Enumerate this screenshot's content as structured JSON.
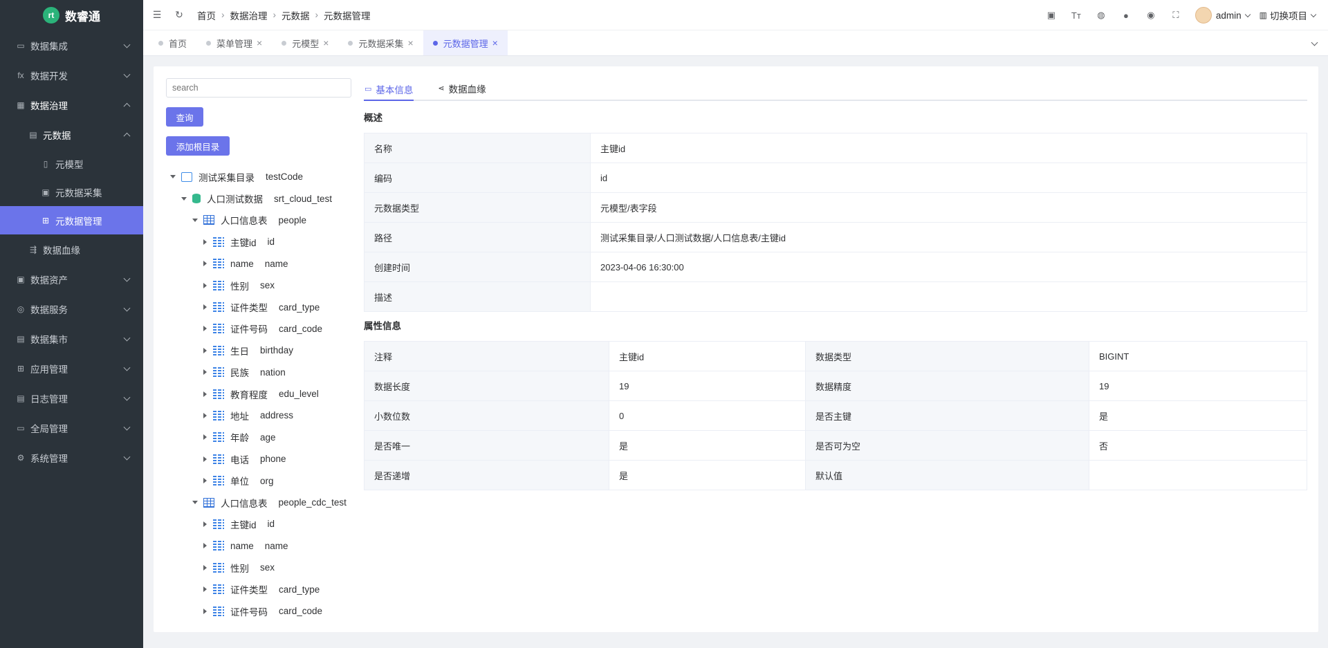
{
  "app": {
    "name": "数睿通",
    "logo_text": "rt"
  },
  "sidebar": {
    "items": [
      {
        "label": "数据集成",
        "icon": "monitor-icon",
        "glyph": "▭"
      },
      {
        "label": "数据开发",
        "icon": "fx-icon",
        "glyph": "fx"
      },
      {
        "label": "数据治理",
        "icon": "grid-icon",
        "glyph": "▦"
      },
      {
        "label": "元数据",
        "icon": "document-icon",
        "glyph": "▤"
      },
      {
        "label": "元模型",
        "icon": "file-icon",
        "glyph": "▯"
      },
      {
        "label": "元数据采集",
        "icon": "collect-icon",
        "glyph": "▣"
      },
      {
        "label": "元数据管理",
        "icon": "manage-icon",
        "glyph": "⊞"
      },
      {
        "label": "数据血缘",
        "icon": "lineage-icon",
        "glyph": "⇶"
      },
      {
        "label": "数据资产",
        "icon": "asset-icon",
        "glyph": "▣"
      },
      {
        "label": "数据服务",
        "icon": "service-icon",
        "glyph": "◎"
      },
      {
        "label": "数据集市",
        "icon": "market-icon",
        "glyph": "▤"
      },
      {
        "label": "应用管理",
        "icon": "apps-icon",
        "glyph": "⊞"
      },
      {
        "label": "日志管理",
        "icon": "log-icon",
        "glyph": "▤"
      },
      {
        "label": "全局管理",
        "icon": "global-icon",
        "glyph": "▭"
      },
      {
        "label": "系统管理",
        "icon": "settings-icon",
        "glyph": "⚙"
      }
    ]
  },
  "topbar": {
    "breadcrumbs": [
      "首页",
      "数据治理",
      "元数据",
      "元数据管理"
    ],
    "user": "admin",
    "project_switch": "切换项目"
  },
  "tabs": [
    {
      "label": "首页"
    },
    {
      "label": "菜单管理"
    },
    {
      "label": "元模型"
    },
    {
      "label": "元数据采集"
    },
    {
      "label": "元数据管理"
    }
  ],
  "left_panel": {
    "search_placeholder": "search",
    "query_button": "查询",
    "add_root_button": "添加根目录"
  },
  "tree": [
    {
      "depth": 0,
      "type": "folder",
      "name": "测试采集目录",
      "code": "testCode",
      "expanded": true
    },
    {
      "depth": 1,
      "type": "db",
      "name": "人口测试数据",
      "code": "srt_cloud_test",
      "expanded": true
    },
    {
      "depth": 2,
      "type": "table",
      "name": "人口信息表",
      "code": "people",
      "expanded": true
    },
    {
      "depth": 3,
      "type": "field",
      "name": "主键id",
      "code": "id"
    },
    {
      "depth": 3,
      "type": "field",
      "name": "name",
      "code": "name"
    },
    {
      "depth": 3,
      "type": "field",
      "name": "性别",
      "code": "sex"
    },
    {
      "depth": 3,
      "type": "field",
      "name": "证件类型",
      "code": "card_type"
    },
    {
      "depth": 3,
      "type": "field",
      "name": "证件号码",
      "code": "card_code"
    },
    {
      "depth": 3,
      "type": "field",
      "name": "生日",
      "code": "birthday"
    },
    {
      "depth": 3,
      "type": "field",
      "name": "民族",
      "code": "nation"
    },
    {
      "depth": 3,
      "type": "field",
      "name": "教育程度",
      "code": "edu_level"
    },
    {
      "depth": 3,
      "type": "field",
      "name": "地址",
      "code": "address"
    },
    {
      "depth": 3,
      "type": "field",
      "name": "年龄",
      "code": "age"
    },
    {
      "depth": 3,
      "type": "field",
      "name": "电话",
      "code": "phone"
    },
    {
      "depth": 3,
      "type": "field",
      "name": "单位",
      "code": "org"
    },
    {
      "depth": 2,
      "type": "table",
      "name": "人口信息表",
      "code": "people_cdc_test",
      "expanded": true
    },
    {
      "depth": 3,
      "type": "field",
      "name": "主键id",
      "code": "id"
    },
    {
      "depth": 3,
      "type": "field",
      "name": "name",
      "code": "name"
    },
    {
      "depth": 3,
      "type": "field",
      "name": "性别",
      "code": "sex"
    },
    {
      "depth": 3,
      "type": "field",
      "name": "证件类型",
      "code": "card_type"
    },
    {
      "depth": 3,
      "type": "field",
      "name": "证件号码",
      "code": "card_code"
    }
  ],
  "detail": {
    "tabs": [
      {
        "label": "基本信息"
      },
      {
        "label": "数据血缘"
      }
    ],
    "overview_title": "概述",
    "overview": [
      {
        "key": "名称",
        "value": "主键id"
      },
      {
        "key": "编码",
        "value": "id"
      },
      {
        "key": "元数据类型",
        "value": "元模型/表字段"
      },
      {
        "key": "路径",
        "value": "测试采集目录/人口测试数据/人口信息表/主键id"
      },
      {
        "key": "创建时间",
        "value": "2023-04-06 16:30:00"
      },
      {
        "key": "描述",
        "value": ""
      }
    ],
    "attr_title": "属性信息",
    "attrs": [
      [
        {
          "key": "注释",
          "value": "主键id"
        },
        {
          "key": "数据类型",
          "value": "BIGINT"
        }
      ],
      [
        {
          "key": "数据长度",
          "value": "19"
        },
        {
          "key": "数据精度",
          "value": "19"
        }
      ],
      [
        {
          "key": "小数位数",
          "value": "0"
        },
        {
          "key": "是否主键",
          "value": "是"
        }
      ],
      [
        {
          "key": "是否唯一",
          "value": "是"
        },
        {
          "key": "是否可为空",
          "value": "否"
        }
      ],
      [
        {
          "key": "是否递增",
          "value": "是"
        },
        {
          "key": "默认值",
          "value": ""
        }
      ]
    ]
  },
  "colors": {
    "accent": "#6b74ea",
    "sidebar_bg": "#2b333a"
  }
}
